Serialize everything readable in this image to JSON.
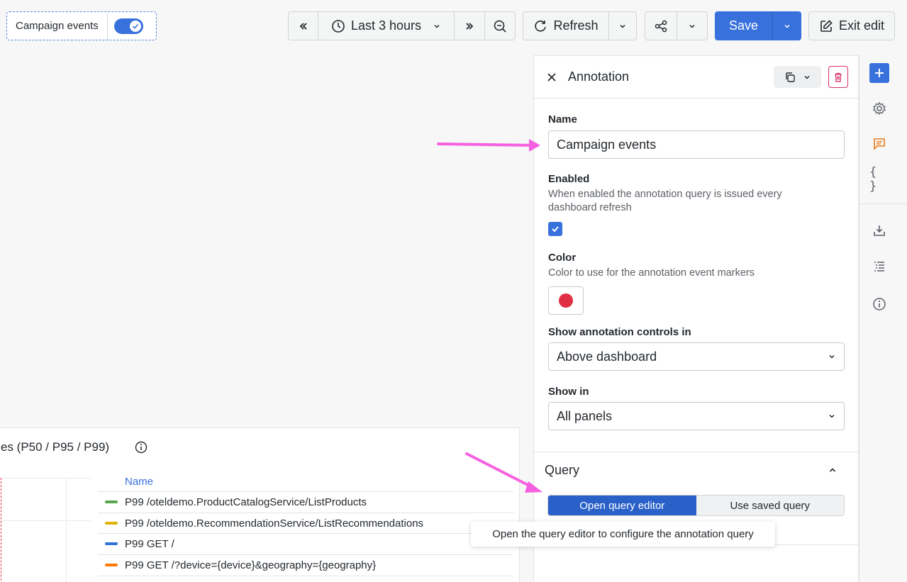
{
  "annotation_toggle": {
    "label": "Campaign events",
    "enabled": true
  },
  "toolbar": {
    "time_range": "Last 3 hours",
    "refresh": "Refresh",
    "save": "Save",
    "exit_edit": "Exit edit"
  },
  "panel": {
    "title": "Annotation",
    "name_label": "Name",
    "name_value": "Campaign events",
    "enabled_label": "Enabled",
    "enabled_desc": "When enabled the annotation query is issued every dashboard refresh",
    "enabled_checked": true,
    "color_label": "Color",
    "color_desc": "Color to use for the annotation event markers",
    "color_value": "#e02f44",
    "controls_label": "Show annotation controls in",
    "controls_value": "Above dashboard",
    "show_in_label": "Show in",
    "show_in_value": "All panels",
    "query_title": "Query",
    "query_tabs": [
      "Open query editor",
      "Use saved query"
    ],
    "tooltip": "Open the query editor to configure the annotation query"
  },
  "dashboard_panel": {
    "title": "es (P50 / P95 / P99)",
    "legend_header": "Name",
    "legend": [
      {
        "name": "P99 /oteldemo.ProductCatalogService/ListProducts",
        "color": "#56a64b"
      },
      {
        "name": "P99 /oteldemo.RecommendationService/ListRecommendations",
        "color": "#e0b400"
      },
      {
        "name": "P99 GET /",
        "color": "#3274d9"
      },
      {
        "name": "P99 GET /?device={device}&geography={geography}",
        "color": "#ff780a"
      }
    ]
  },
  "colors": {
    "accent": "#3871dc",
    "annotation_arrow": "#f560e0",
    "delete": "#d6306a"
  }
}
